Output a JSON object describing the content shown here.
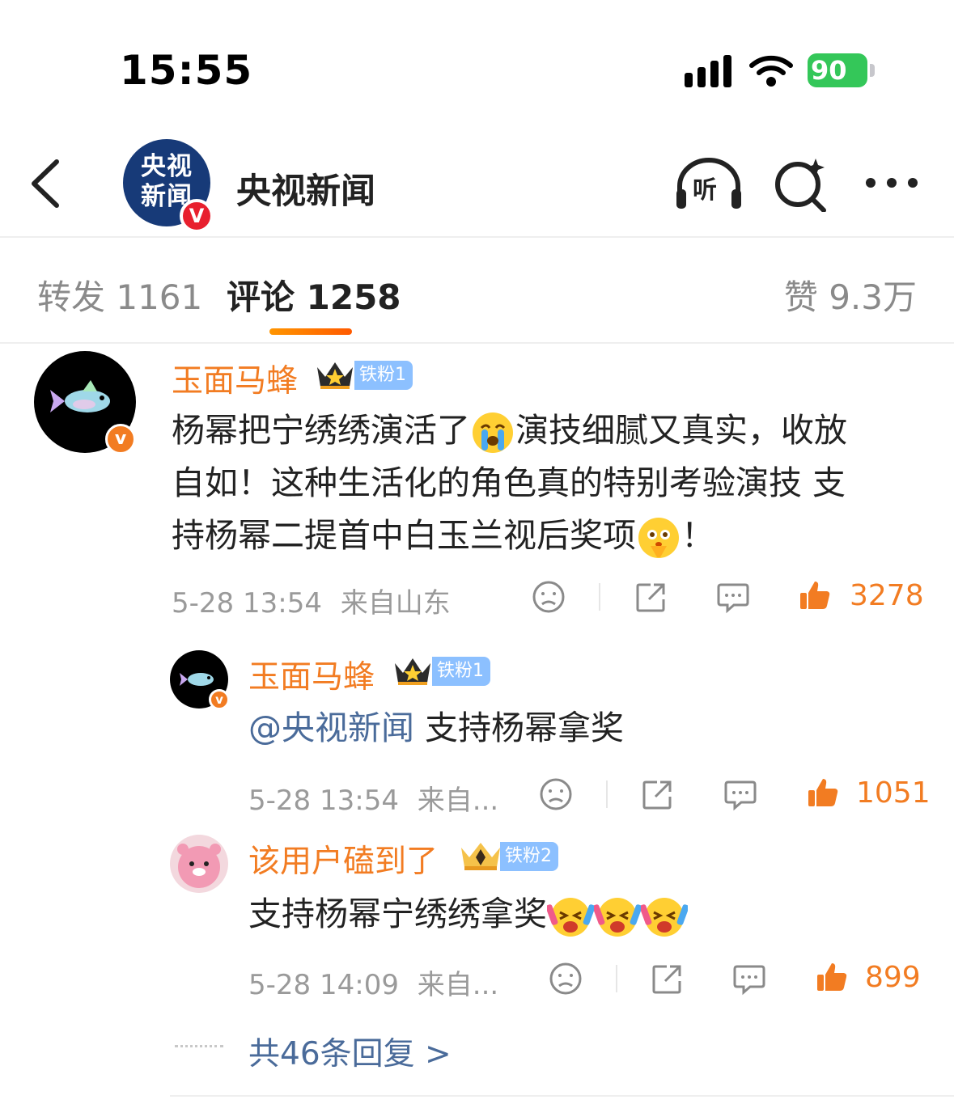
{
  "status_bar": {
    "time": "15:55",
    "battery": "90"
  },
  "header": {
    "title": "央视新闻",
    "avatar_text": "央视新闻",
    "listen_label": "听"
  },
  "tabs": [
    {
      "label": "转发 1161"
    },
    {
      "label": "评论 1258"
    },
    {
      "label": "赞 9.3万"
    }
  ],
  "comments": [
    {
      "user": "玉面马蜂",
      "fan_badge": "铁粉1",
      "text_parts": [
        "杨幂把宁绣绣演活了",
        "演技细腻又真实，收放",
        "自如！这种生活化的角色真的特别考验演技 支",
        "持杨幂二提首中白玉兰视后奖项",
        "！"
      ],
      "time": "5-28 13:54",
      "location": "来自山东",
      "likes": "3278"
    },
    {
      "user": "玉面马蜂",
      "fan_badge": "铁粉1",
      "mention": "@央视新闻",
      "text": " 支持杨幂拿奖",
      "time": "5-28 13:54",
      "location": "来自...",
      "likes": "1051"
    },
    {
      "user": "该用户磕到了",
      "fan_badge": "铁粉2",
      "text": "支持杨幂宁绣绣拿奖",
      "time": "5-28 14:09",
      "location": "来自...",
      "likes": "899"
    }
  ],
  "more_replies": "共46条回复 >",
  "colors": {
    "accent": "#f27c22",
    "link": "#4a6b9a",
    "battery": "#34c759",
    "verified_red": "#e8202e"
  }
}
